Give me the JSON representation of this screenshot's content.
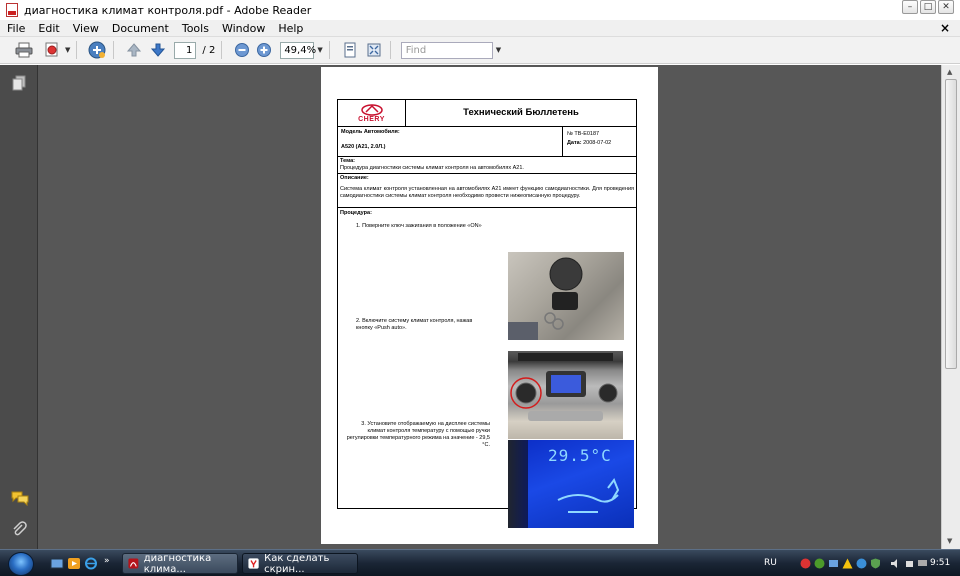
{
  "window": {
    "title": "диагностика климат контроля.pdf - Adobe Reader",
    "minimize_label": "–",
    "maximize_label": "□",
    "close_label": "✕"
  },
  "menu": {
    "items": [
      "File",
      "Edit",
      "View",
      "Document",
      "Tools",
      "Window",
      "Help"
    ],
    "close_document": "×"
  },
  "toolbar": {
    "current_page": "1",
    "page_total": "/ 2",
    "zoom": "49,4%",
    "find_placeholder": "Find"
  },
  "document": {
    "brand": "CHERY",
    "header_title": "Технический Бюллетень",
    "model_label": "Модель Автомобиля:",
    "model_value": "А520 (А21, 2.0Л.)",
    "bulletin_no": "№ TB-E0187",
    "date_label": "Дата:",
    "date_value": "2008-07-02",
    "theme_label": "Тема:",
    "theme_value": "Процедура диагностики системы климат контроля на автомобилях А21.",
    "description_label": "Описание:",
    "description_value": "Система климат контроля установленная на автомобилях А21 имеет функцию самодиагностики. Для проведения самодиагностики системы климат контроля необходимо провести нижеописанную процедуру.",
    "procedure_label": "Процедура:",
    "steps": [
      "1.   Поверните ключ зажигания в положение «ON»",
      "2.   Включите систему климат контроля, нажав кнопку «Push auto».",
      "3. Установите отображаемую на дисплее системы климат контроля температуру с помощью ручки регулировки температурного режима на значение -  29,5 °С."
    ],
    "lcd_reading": "29.5°C"
  },
  "taskbar": {
    "tasks": [
      "диагностика клима...",
      "Как сделать скрин..."
    ],
    "language": "RU",
    "clock": "9:51"
  },
  "colors": {
    "doc_background": "#575757",
    "brand_red": "#c8102e",
    "lcd_blue": "#1a49e6"
  }
}
